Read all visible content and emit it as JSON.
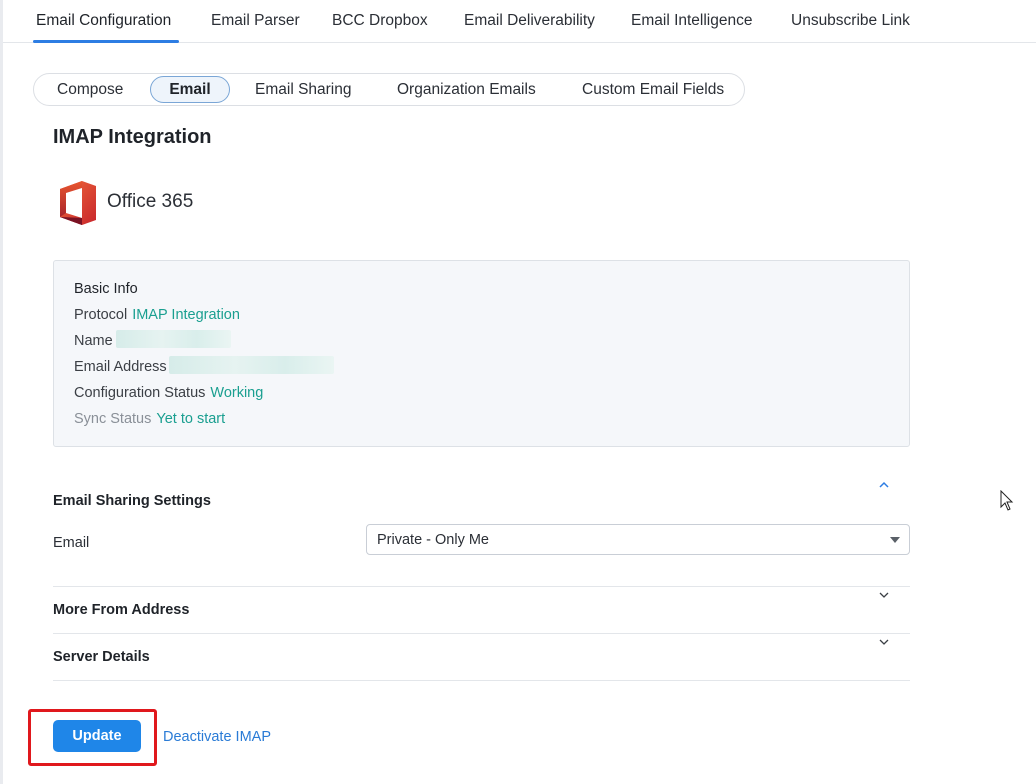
{
  "top_tabs": [
    {
      "label": "Email Configuration",
      "active": true
    },
    {
      "label": "Email Parser"
    },
    {
      "label": "BCC Dropbox"
    },
    {
      "label": "Email Deliverability"
    },
    {
      "label": "Email Intelligence"
    },
    {
      "label": "Unsubscribe Link"
    }
  ],
  "sub_tabs": [
    {
      "label": "Compose"
    },
    {
      "label": "Email",
      "active": true
    },
    {
      "label": "Email Sharing"
    },
    {
      "label": "Organization Emails"
    },
    {
      "label": "Custom Email Fields"
    }
  ],
  "section_title": "IMAP Integration",
  "provider": {
    "name": "Office 365",
    "icon": "office-365-icon"
  },
  "basic_info": {
    "heading": "Basic Info",
    "protocol_label": "Protocol",
    "protocol_value": "IMAP Integration",
    "name_label": "Name",
    "email_label": "Email Address",
    "config_status_label": "Configuration Status",
    "config_status_value": "Working",
    "sync_status_label": "Sync Status",
    "sync_status_value": "Yet to start"
  },
  "sharing": {
    "heading": "Email Sharing Settings",
    "field_label": "Email",
    "selected": "Private - Only Me",
    "expanded": true
  },
  "more_from_address": {
    "heading": "More From Address",
    "expanded": false
  },
  "server_details": {
    "heading": "Server Details",
    "expanded": false
  },
  "actions": {
    "update_label": "Update",
    "deactivate_label": "Deactivate IMAP"
  },
  "colors": {
    "accent": "#1f86e8",
    "status_green": "#1a9f90",
    "highlight": "#e0181d",
    "link": "#2a7bd6"
  }
}
